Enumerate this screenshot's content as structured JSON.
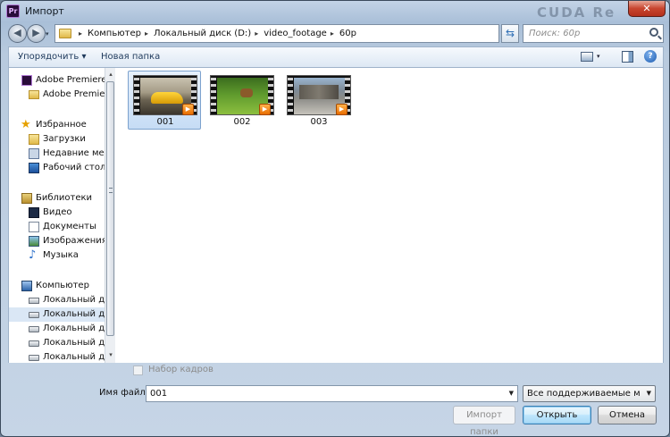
{
  "window": {
    "title": "Импорт",
    "app_icon_text": "Pr",
    "watermark": "CUDA Re",
    "close_glyph": "✕"
  },
  "nav": {
    "back_glyph": "◀",
    "forward_glyph": "▶",
    "history_glyph": "▾",
    "breadcrumb": [
      "Компьютер",
      "Локальный диск (D:)",
      "video_footage",
      "60p"
    ],
    "crumb_sep": "▸",
    "address_drop_glyph": "▾",
    "refresh_glyph": "⇆",
    "search_placeholder": "Поиск: 60p"
  },
  "toolbar": {
    "organize_label": "Упорядочить ▾",
    "new_folder_label": "Новая папка",
    "view_arrow_glyph": "▾",
    "help_glyph": "?"
  },
  "sidebar": {
    "items": [
      {
        "label": "Adobe Premiere Pr",
        "icon": "premiere-icon"
      },
      {
        "label": "Adobe Premiere",
        "icon": "folder-icon"
      },
      {
        "label": "Избранное",
        "icon": "star-icon"
      },
      {
        "label": "Загрузки",
        "icon": "downloads-icon"
      },
      {
        "label": "Недавние места",
        "icon": "recent-places-icon"
      },
      {
        "label": "Рабочий стол",
        "icon": "desktop-icon"
      },
      {
        "label": "Библиотеки",
        "icon": "libraries-icon"
      },
      {
        "label": "Видео",
        "icon": "video-library-icon"
      },
      {
        "label": "Документы",
        "icon": "documents-icon"
      },
      {
        "label": "Изображения",
        "icon": "pictures-icon"
      },
      {
        "label": "Музыка",
        "icon": "music-icon"
      },
      {
        "label": "Компьютер",
        "icon": "computer-icon"
      },
      {
        "label": "Локальный диск",
        "icon": "system-drive-icon"
      },
      {
        "label": "Локальный диск",
        "icon": "drive-icon"
      },
      {
        "label": "Локальный диск",
        "icon": "drive-icon"
      },
      {
        "label": "Локальный диск",
        "icon": "drive-icon"
      },
      {
        "label": "Локальный диск",
        "icon": "drive-icon"
      }
    ],
    "selected_index": 13,
    "star_glyph": "★",
    "music_glyph": "♪"
  },
  "files": [
    {
      "name": "001",
      "selected": true
    },
    {
      "name": "002",
      "selected": false
    },
    {
      "name": "003",
      "selected": false
    }
  ],
  "play_glyph": "▶",
  "scroll": {
    "up_glyph": "▴",
    "down_glyph": "▾"
  },
  "bottom": {
    "image_sequence_label": "Набор кадров",
    "image_sequence_checked": false,
    "filename_label": "Имя файла:",
    "filename_value": "001",
    "filename_drop_glyph": "▼",
    "filetype_value": "Все поддерживаемые мультимедиа",
    "filetype_drop_glyph": "▼",
    "import_folder_label": "Импорт папки",
    "open_label": "Открыть",
    "cancel_label": "Отмена"
  },
  "colors": {
    "selection": "#c6dcf5",
    "accent": "#3c7fb1",
    "close": "#c8452f"
  }
}
